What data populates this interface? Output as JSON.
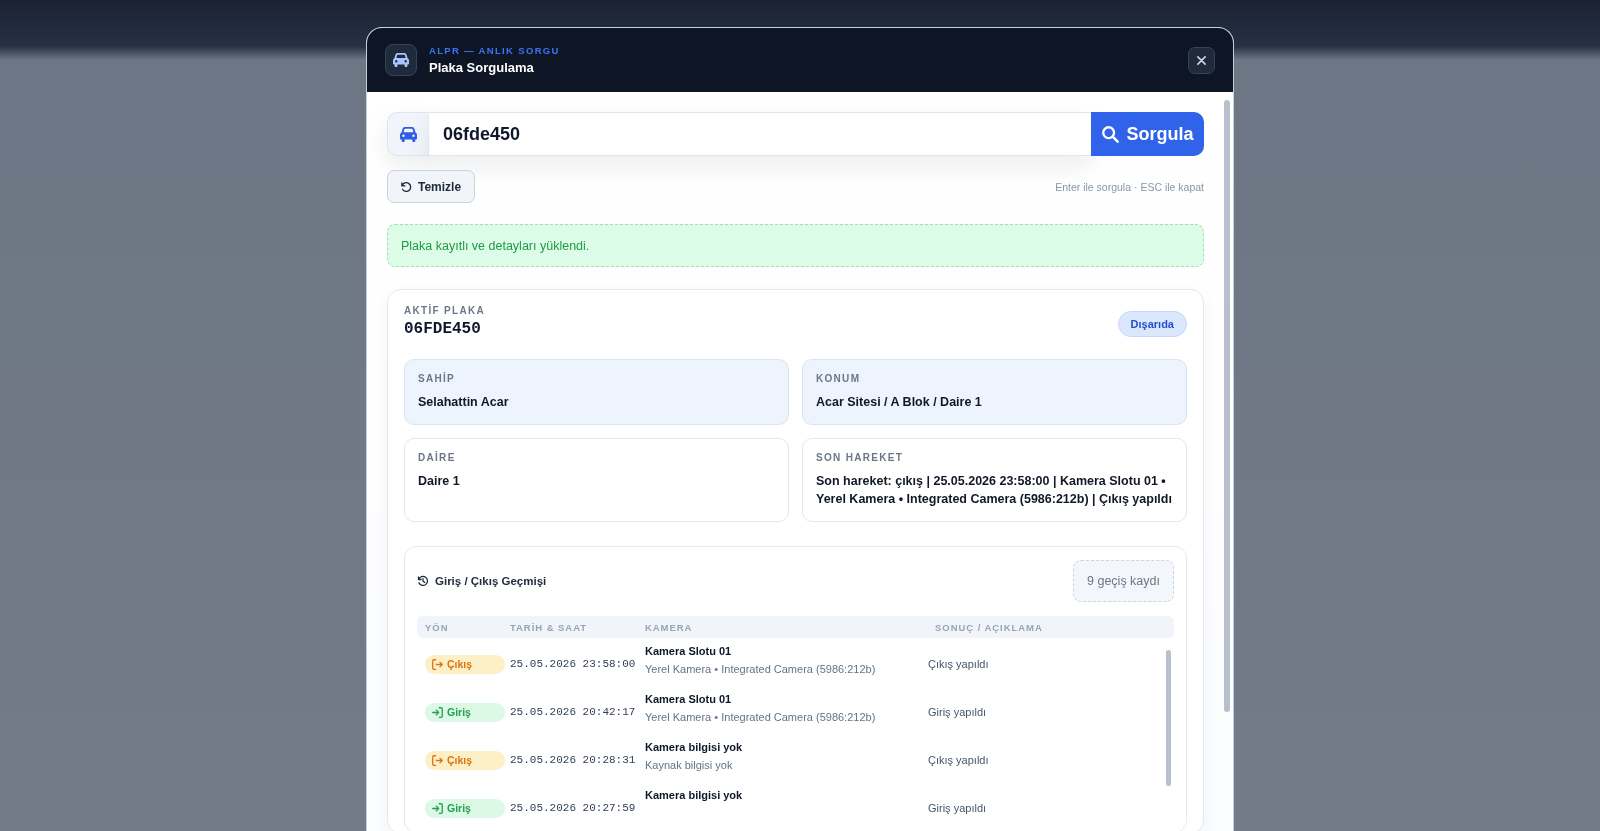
{
  "modal": {
    "eyebrow": "ALPR — ANLIK SORGU",
    "title": "Plaka Sorgulama"
  },
  "search": {
    "value": "06fde450",
    "button": "Sorgula"
  },
  "actions": {
    "clear_button": "Temizle",
    "hint": "Enter ile sorgula · ESC ile kapat"
  },
  "alert": {
    "kind": "success",
    "text": "Plaka kayıtlı ve detayları yüklendi."
  },
  "plate": {
    "label": "AKTİF PLAKA",
    "number": "06FDE450",
    "status": "Dışarıda"
  },
  "details": [
    {
      "label": "SAHİP",
      "value": "Selahattin Acar",
      "highlighted": true
    },
    {
      "label": "KONUM",
      "value": "Acar Sitesi / A Blok / Daire 1",
      "highlighted": true
    },
    {
      "label": "DAİRE",
      "value": "Daire 1",
      "highlighted": false
    },
    {
      "label": "SON HAREKET",
      "value": "Son hareket: çıkış | 25.05.2026 23:58:00 | Kamera Slotu 01 • Yerel Kamera • Integrated Camera (5986:212b) | Çıkış yapıldı",
      "highlighted": false
    }
  ],
  "history": {
    "title": "Giriş / Çıkış Geçmişi",
    "count": "9 geçiş kaydı",
    "columns": [
      "YÖN",
      "TARİH & SAAT",
      "KAMERA",
      "SONUÇ / AÇIKLAMA"
    ],
    "rows": [
      {
        "kind": "exit",
        "direction": "Çıkış",
        "datetime": "25.05.2026 23:58:00",
        "camera": "Kamera Slotu 01",
        "source": "Yerel Kamera • Integrated Camera (5986:212b)",
        "result": "Çıkış yapıldı"
      },
      {
        "kind": "entry",
        "direction": "Giriş",
        "datetime": "25.05.2026 20:42:17",
        "camera": "Kamera Slotu 01",
        "source": "Yerel Kamera • Integrated Camera (5986:212b)",
        "result": "Giriş yapıldı"
      },
      {
        "kind": "exit",
        "direction": "Çıkış",
        "datetime": "25.05.2026 20:28:31",
        "camera": "Kamera bilgisi yok",
        "source": "Kaynak bilgisi yok",
        "result": "Çıkış yapıldı"
      },
      {
        "kind": "entry",
        "direction": "Giriş",
        "datetime": "25.05.2026 20:27:59",
        "camera": "Kamera bilgisi yok",
        "result": "Giriş yapıldı"
      }
    ]
  }
}
